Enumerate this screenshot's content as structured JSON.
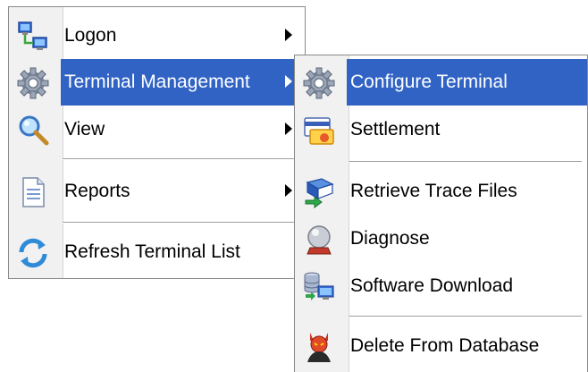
{
  "main_menu": {
    "items": [
      {
        "label": "Logon",
        "icon": "computers-network-icon",
        "has_submenu": true
      },
      {
        "label": "Terminal Management",
        "icon": "gear-icon",
        "has_submenu": true,
        "highlighted": true
      },
      {
        "label": "View",
        "icon": "magnifier-icon",
        "has_submenu": true
      },
      {
        "label": "Reports",
        "icon": "document-icon",
        "has_submenu": true
      },
      {
        "label": "Refresh Terminal List",
        "icon": "refresh-icon",
        "has_submenu": false
      }
    ]
  },
  "sub_menu": {
    "items": [
      {
        "label": "Configure Terminal",
        "icon": "gear-icon",
        "highlighted": true
      },
      {
        "label": "Settlement",
        "icon": "settlement-card-icon"
      },
      {
        "label": "Retrieve Trace Files",
        "icon": "book-arrow-icon"
      },
      {
        "label": "Diagnose",
        "icon": "crystal-ball-icon"
      },
      {
        "label": "Software Download",
        "icon": "database-computer-icon"
      },
      {
        "label": "Delete From Database",
        "icon": "devil-icon"
      }
    ]
  },
  "colors": {
    "highlight": "#3163c5",
    "gutter": "#f1f1f1",
    "border": "#8a8a8a"
  }
}
